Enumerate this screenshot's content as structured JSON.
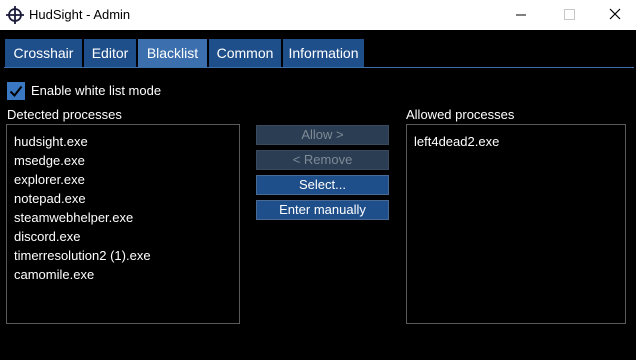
{
  "window": {
    "title": "HudSight - Admin"
  },
  "tabs": [
    {
      "label": "Crosshair"
    },
    {
      "label": "Editor"
    },
    {
      "label": "Blacklist",
      "active": true
    },
    {
      "label": "Common"
    },
    {
      "label": "Information"
    }
  ],
  "whitelist": {
    "label": "Enable white list mode",
    "checked": true
  },
  "detected": {
    "label": "Detected processes",
    "items": [
      "hudsight.exe",
      "msedge.exe",
      "explorer.exe",
      "notepad.exe",
      "steamwebhelper.exe",
      "discord.exe",
      "timerresolution2 (1).exe",
      "camomile.exe"
    ]
  },
  "allowed": {
    "label": "Allowed processes",
    "items": [
      "left4dead2.exe"
    ]
  },
  "actions": {
    "allow": "Allow >",
    "remove": "< Remove",
    "select": "Select...",
    "enter_manually": "Enter manually"
  },
  "colors": {
    "accent": "#3b6fae",
    "tab": "#1f4f8a",
    "checkbox": "#3b78c4"
  }
}
